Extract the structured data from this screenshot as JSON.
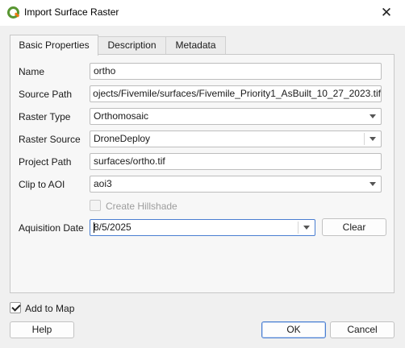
{
  "window": {
    "title": "Import Surface Raster",
    "close_glyph": "✕",
    "app_icon": "qgis-icon"
  },
  "tabs": [
    {
      "label": "Basic Properties",
      "active": true
    },
    {
      "label": "Description",
      "active": false
    },
    {
      "label": "Metadata",
      "active": false
    }
  ],
  "form": {
    "name_label": "Name",
    "name_value": "ortho",
    "source_path_label": "Source Path",
    "source_path_value": "ojects/Fivemile/surfaces/Fivemile_Priority1_AsBuilt_10_27_2023.tif",
    "raster_type_label": "Raster Type",
    "raster_type_value": "Orthomosaic",
    "raster_source_label": "Raster Source",
    "raster_source_value": "DroneDeploy",
    "project_path_label": "Project Path",
    "project_path_value": "surfaces/ortho.tif",
    "clip_label": "Clip to AOI",
    "clip_value": "aoi3",
    "hillshade_label": "Create Hillshade",
    "hillshade_checked": false,
    "hillshade_enabled": false,
    "date_label": "Aquisition Date",
    "date_value": "8/5/2025",
    "clear_label": "Clear"
  },
  "footer": {
    "add_to_map_label": "Add to Map",
    "add_to_map_checked": true,
    "help_label": "Help",
    "ok_label": "OK",
    "cancel_label": "Cancel"
  },
  "colors": {
    "accent": "#4a7ed1",
    "app_green": "#589632",
    "app_orange": "#ee7913"
  }
}
